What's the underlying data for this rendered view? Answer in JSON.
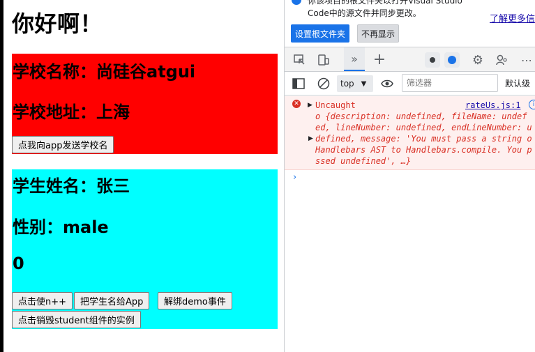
{
  "app": {
    "greeting": "你好啊！",
    "school": {
      "name_line": "学校名称：尚硅谷atgui",
      "address_line": "学校地址：上海",
      "send_button": "点我向app发送学校名"
    },
    "student": {
      "name_line": "学生姓名：张三",
      "gender_line": "性别：male",
      "count": "0",
      "buttons": {
        "increment": "点击使n++",
        "send_name": "把学生名给App",
        "unbind": "解绑demo事件",
        "destroy": "点击销毁student组件的实例"
      }
    },
    "colors": {
      "school_bg": "#ff0000",
      "student_bg": "#00ffff"
    }
  },
  "devtools": {
    "banner": {
      "line1": "你该项目的根文件夹以打开Visual Studio",
      "line2": "Code中的源文件并同步更改。",
      "learn_more": "了解更多信",
      "set_root_button": "设置根文件夹",
      "dismiss_button": "不再显示"
    },
    "toolbar": {
      "icons": [
        "inspect-icon",
        "device-toolbar-icon",
        "more-tabs-icon",
        "add-tab-icon",
        "issues-icon",
        "chat-icon",
        "settings-icon",
        "customize-icon",
        "menu-icon"
      ]
    },
    "console_toolbar": {
      "context": "top",
      "filter_placeholder": "筛选器",
      "level": "默认级"
    },
    "error": {
      "label": "Uncaught",
      "source": "rateUs.js:1",
      "lines": [
        "o {description: undefined, fileName: undef",
        "ed, lineNumber: undefined, endLineNumber: u",
        "defined, message: 'You must pass a string o",
        "Handlebars AST to Handlebars.compile. You p",
        "ssed undefined', …}"
      ]
    },
    "prompt": "›"
  }
}
